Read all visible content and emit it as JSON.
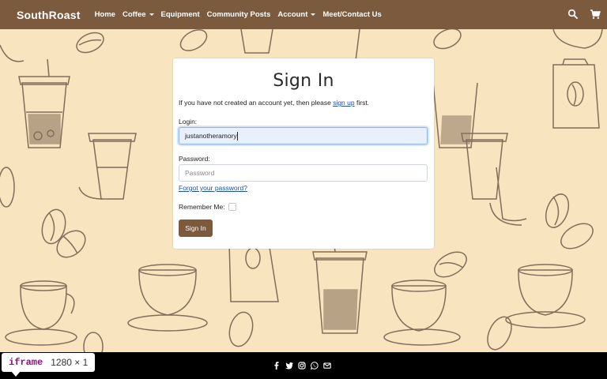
{
  "navbar": {
    "brand": "SouthRoast",
    "items": [
      {
        "label": "Home",
        "dropdown": false
      },
      {
        "label": "Coffee",
        "dropdown": true
      },
      {
        "label": "Equipment",
        "dropdown": false
      },
      {
        "label": "Community Posts",
        "dropdown": false
      },
      {
        "label": "Account",
        "dropdown": true
      },
      {
        "label": "Meet/Contact Us",
        "dropdown": false
      }
    ],
    "icons": [
      "search-icon",
      "cart-icon"
    ]
  },
  "signin": {
    "title": "Sign In",
    "intro_before": "If you have not created an account yet, then please",
    "intro_link": "sign up",
    "intro_after": "first.",
    "login_label": "Login:",
    "login_value": "justanotheramory",
    "password_label": "Password:",
    "password_placeholder": "Password",
    "forgot_link": "Forgot your password?",
    "remember_label": "Remember Me:",
    "submit_label": "Sign In"
  },
  "footer": {
    "social_icons": [
      "facebook-icon",
      "twitter-icon",
      "instagram-icon",
      "whatsapp-icon",
      "email-icon"
    ]
  },
  "devtools_badge": {
    "tag": "iframe",
    "dimensions": "1280 × 1"
  },
  "colors": {
    "brand": "#7b5a3e",
    "background": "#f8e4bf",
    "link": "#1f4fa3",
    "footer": "#000000"
  }
}
